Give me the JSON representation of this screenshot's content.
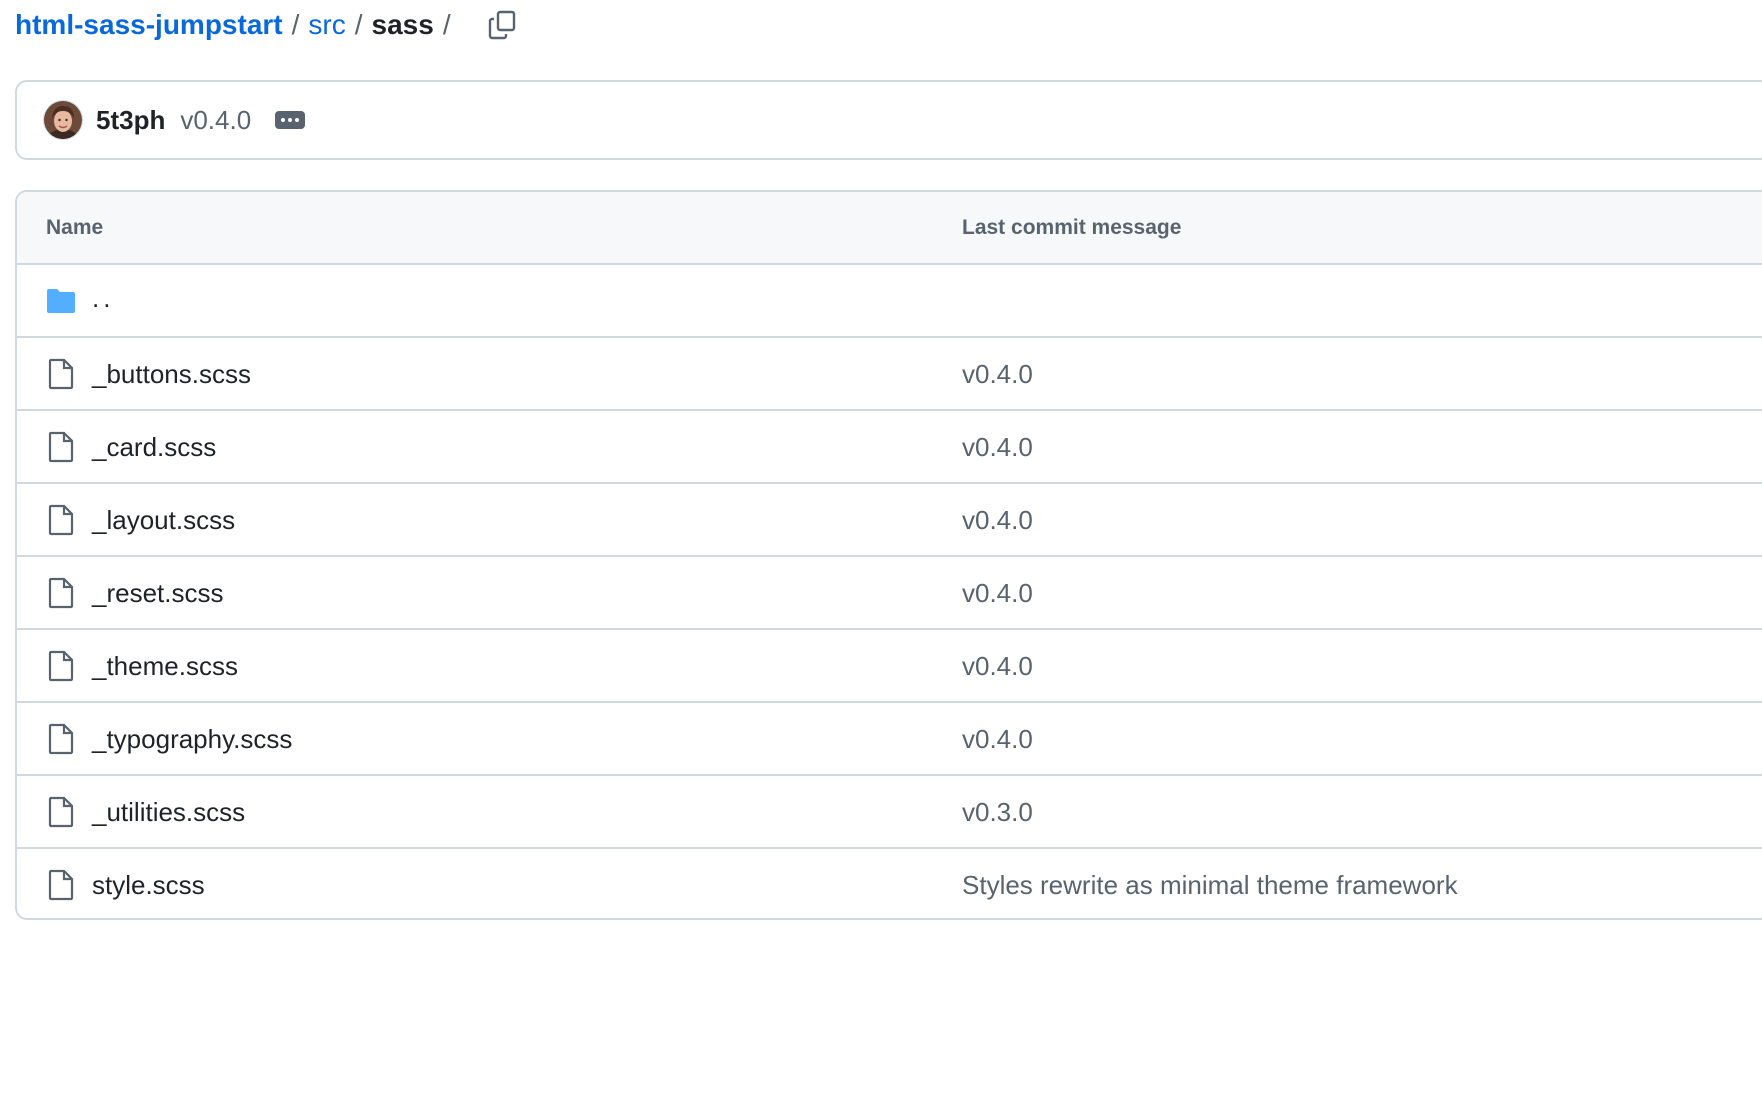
{
  "breadcrumb": {
    "repo": "html-sass-jumpstart",
    "folder": "src",
    "current": "sass",
    "separator": "/"
  },
  "latest_commit": {
    "author": "5t3ph",
    "message": "v0.4.0"
  },
  "table": {
    "headers": {
      "name": "Name",
      "message": "Last commit message"
    },
    "parent_dir": "..",
    "files": [
      {
        "name": "_buttons.scss",
        "message": "v0.4.0"
      },
      {
        "name": "_card.scss",
        "message": "v0.4.0"
      },
      {
        "name": "_layout.scss",
        "message": "v0.4.0"
      },
      {
        "name": "_reset.scss",
        "message": "v0.4.0"
      },
      {
        "name": "_theme.scss",
        "message": "v0.4.0"
      },
      {
        "name": "_typography.scss",
        "message": "v0.4.0"
      },
      {
        "name": "_utilities.scss",
        "message": "v0.3.0"
      },
      {
        "name": "style.scss",
        "message": "Styles rewrite as minimal theme framework"
      }
    ]
  },
  "icons": {
    "copy": "copy-icon",
    "folder": "folder-icon",
    "file": "file-icon",
    "ellipsis": "kebab-horizontal-icon"
  },
  "colors": {
    "link": "#0969da",
    "muted": "#59636e",
    "border": "#d1d9e0",
    "folder": "#54aeff"
  }
}
